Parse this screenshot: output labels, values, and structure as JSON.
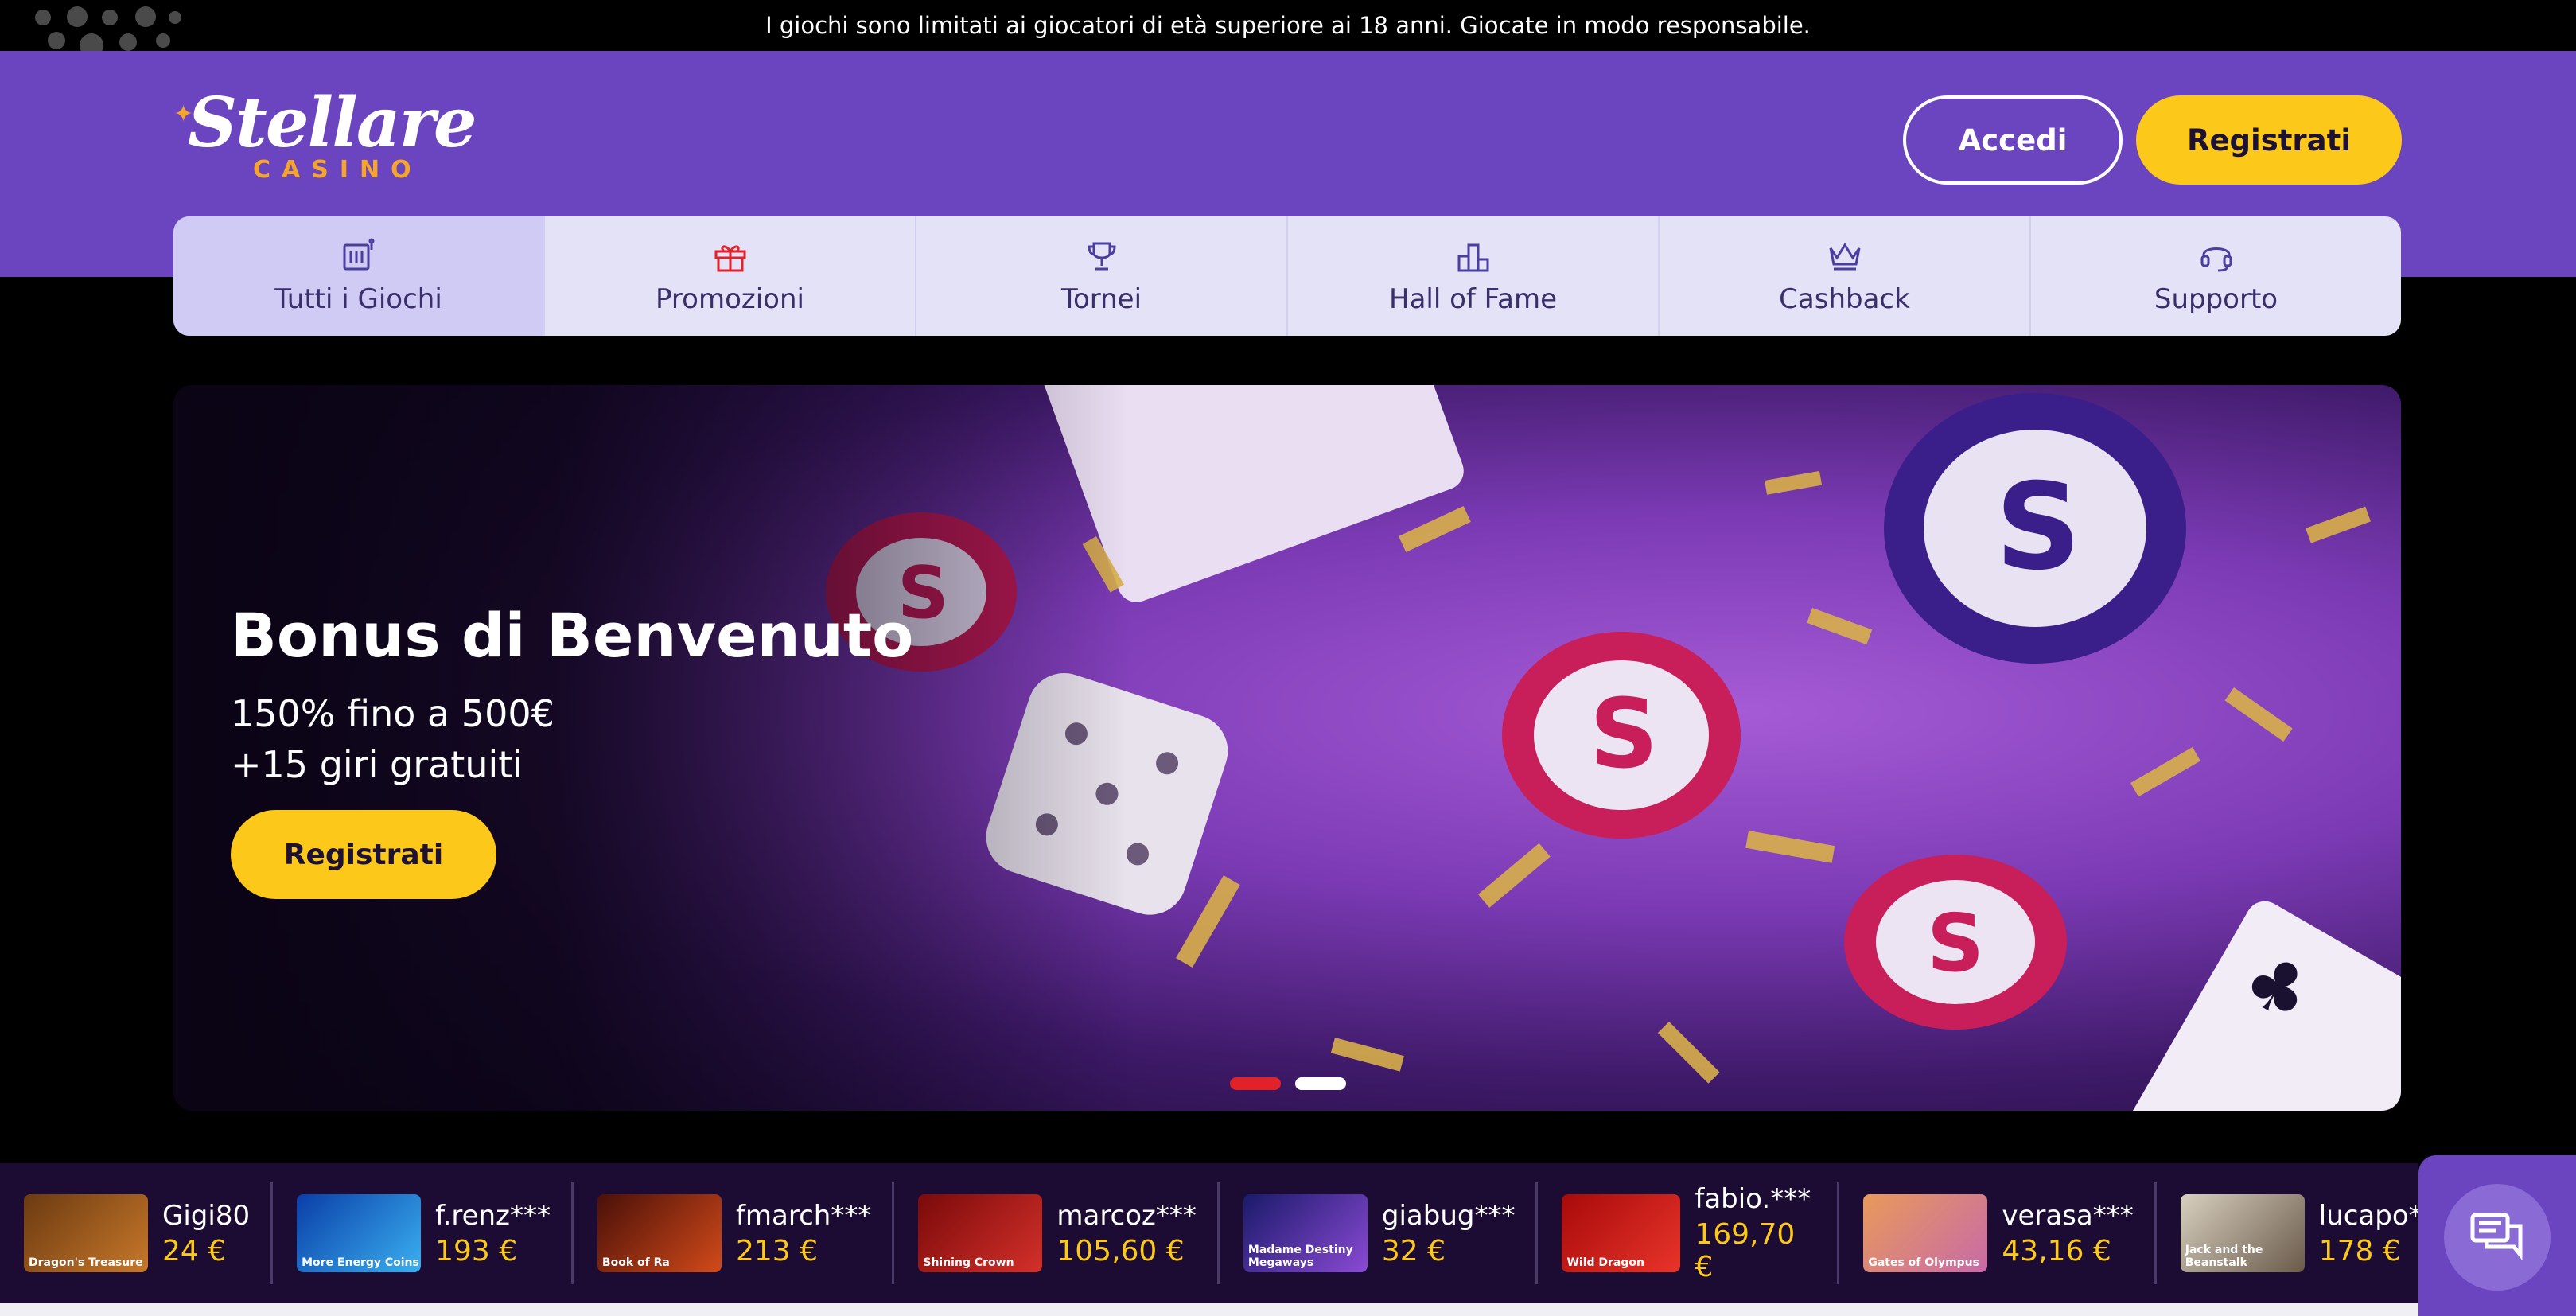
{
  "notice": {
    "text": "I giochi sono limitati ai giocatori di età superiore ai 18 anni. Giocate in modo responsabile."
  },
  "header": {
    "logo_main": "Stellare",
    "logo_sub": "CASINO",
    "login_label": "Accedi",
    "register_label": "Registrati"
  },
  "nav": {
    "items": [
      {
        "label": "Tutti i Giochi",
        "icon": "games-icon",
        "active": true
      },
      {
        "label": "Promozioni",
        "icon": "gift-icon"
      },
      {
        "label": "Tornei",
        "icon": "trophy-icon"
      },
      {
        "label": "Hall of Fame",
        "icon": "podium-icon"
      },
      {
        "label": "Cashback",
        "icon": "crown-icon"
      },
      {
        "label": "Supporto",
        "icon": "headset-icon"
      }
    ]
  },
  "hero": {
    "title": "Bonus di Benvenuto",
    "line1": "150% fino a 500€",
    "line2": "+15 giri gratuiti",
    "cta_label": "Registrati",
    "slides": [
      {
        "active": true
      },
      {
        "active": false
      }
    ]
  },
  "winners": [
    {
      "name": "Gigi80",
      "amount": "24 €",
      "game": "Dragon's Treasure"
    },
    {
      "name": "f.renz***",
      "amount": "193 €",
      "game": "More Energy Coins"
    },
    {
      "name": "fmarch***",
      "amount": "213 €",
      "game": "Book of Ra"
    },
    {
      "name": "marcoz***",
      "amount": "105,60 €",
      "game": "Shining Crown"
    },
    {
      "name": "giabug***",
      "amount": "32 €",
      "game": "Madame Destiny Megaways"
    },
    {
      "name": "fabio.***",
      "amount": "169,70 €",
      "game": "Wild Dragon"
    },
    {
      "name": "verasa***",
      "amount": "43,16 €",
      "game": "Gates of Olympus"
    },
    {
      "name": "lucapo***",
      "amount": "178 €",
      "game": "Jack and the Beanstalk"
    }
  ],
  "colors": {
    "brand": "#6b44c0",
    "accent": "#fcc81a",
    "dot_active": "#e0222b"
  }
}
